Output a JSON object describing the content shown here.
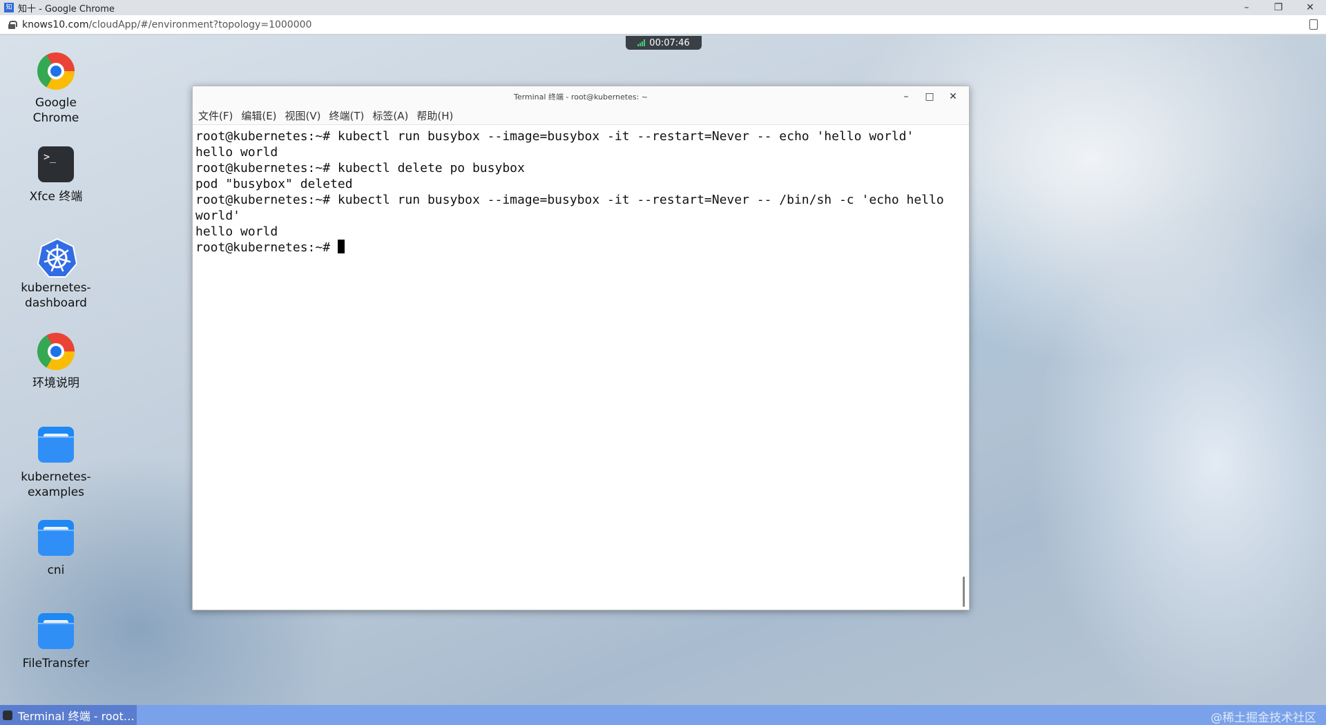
{
  "browser": {
    "tab_favicon": "知",
    "title": "知十 - Google Chrome",
    "url_domain": "knows10.com",
    "url_path": "/cloudApp/#/environment?topology=1000000",
    "controls": {
      "minimize": "–",
      "restore": "❐",
      "close": "✕"
    }
  },
  "timer": {
    "value": "00:07:46"
  },
  "desktop_icons": [
    {
      "label": "Google Chrome",
      "icon": "chrome-icon"
    },
    {
      "label": "Xfce 终端",
      "icon": "terminal-icon"
    },
    {
      "label_line1": "kubernetes-",
      "label_line2": "dashboard",
      "icon": "kubernetes-icon"
    },
    {
      "label": "环境说明",
      "icon": "chrome-icon"
    },
    {
      "label_line1": "kubernetes-",
      "label_line2": "examples",
      "icon": "folder-icon"
    },
    {
      "label": "cni",
      "icon": "folder-icon"
    },
    {
      "label": "FileTransfer",
      "icon": "folder-icon"
    }
  ],
  "terminal": {
    "title": "Terminal 终端 - root@kubernetes: ~",
    "terminal_icon_glyph": ">_",
    "controls": {
      "minimize": "–",
      "maximize": "□",
      "close": "✕"
    },
    "menu": [
      "文件(F)",
      "编辑(E)",
      "视图(V)",
      "终端(T)",
      "标签(A)",
      "帮助(H)"
    ],
    "lines": [
      "root@kubernetes:~# kubectl run busybox --image=busybox -it --restart=Never -- echo 'hello world'",
      "hello world",
      "root@kubernetes:~# kubectl delete po busybox",
      "pod \"busybox\" deleted",
      "root@kubernetes:~# kubectl run busybox --image=busybox -it --restart=Never -- /bin/sh -c 'echo hello world'",
      "hello world"
    ],
    "prompt": "root@kubernetes:~# "
  },
  "taskbar": {
    "task_label": "Terminal 终端 - root…",
    "watermark": "@稀土掘金技术社区"
  },
  "colors": {
    "taskbar": "#7aa2ea",
    "task_active": "#5b7dcf",
    "timer_bg": "#3a3f46",
    "signal": "#3fd07a"
  }
}
